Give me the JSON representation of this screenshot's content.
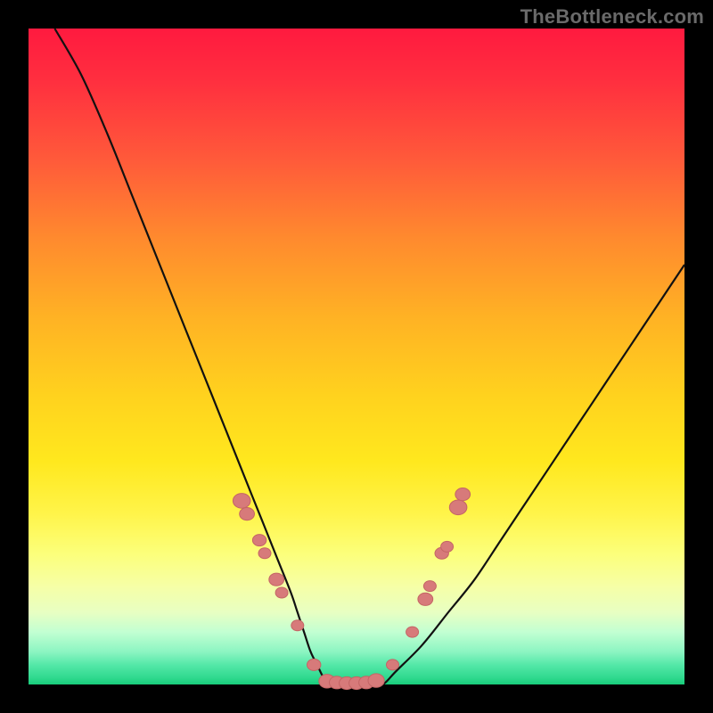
{
  "watermark": "TheBottleneck.com",
  "colors": {
    "frame": "#000000",
    "gradient_top": "#ff1a3f",
    "gradient_bottom": "#18cc7a",
    "curve": "#111111",
    "marker_fill": "#d77a7a",
    "marker_stroke": "#c46565"
  },
  "chart_data": {
    "type": "line",
    "title": "",
    "xlabel": "",
    "ylabel": "",
    "xlim": [
      0,
      100
    ],
    "ylim": [
      0,
      100
    ],
    "grid": false,
    "legend": false,
    "series": [
      {
        "name": "bottleneck-curve",
        "x": [
          4,
          8,
          12,
          16,
          20,
          24,
          28,
          30,
          32,
          34,
          36,
          38,
          40,
          41,
          42,
          43,
          44,
          45,
          46,
          47,
          48,
          50,
          52,
          54,
          56,
          60,
          64,
          68,
          72,
          76,
          80,
          84,
          88,
          92,
          96,
          100
        ],
        "y": [
          100,
          93,
          84,
          74,
          64,
          54,
          44,
          39,
          34,
          29,
          24,
          19,
          14,
          11,
          8,
          5,
          3,
          1,
          0,
          0,
          0,
          0,
          0,
          0,
          2,
          6,
          11,
          16,
          22,
          28,
          34,
          40,
          46,
          52,
          58,
          64
        ]
      }
    ],
    "markers": [
      {
        "x": 32.5,
        "y": 28,
        "r": 1.4
      },
      {
        "x": 33.3,
        "y": 26,
        "r": 1.2
      },
      {
        "x": 35.2,
        "y": 22,
        "r": 1.1
      },
      {
        "x": 36.0,
        "y": 20,
        "r": 1.0
      },
      {
        "x": 37.8,
        "y": 16,
        "r": 1.2
      },
      {
        "x": 38.6,
        "y": 14,
        "r": 1.0
      },
      {
        "x": 41.0,
        "y": 9,
        "r": 1.0
      },
      {
        "x": 43.5,
        "y": 3,
        "r": 1.1
      },
      {
        "x": 45.5,
        "y": 0.5,
        "r": 1.3
      },
      {
        "x": 47.0,
        "y": 0.3,
        "r": 1.2
      },
      {
        "x": 48.5,
        "y": 0.2,
        "r": 1.2
      },
      {
        "x": 50.0,
        "y": 0.2,
        "r": 1.2
      },
      {
        "x": 51.5,
        "y": 0.3,
        "r": 1.2
      },
      {
        "x": 53.0,
        "y": 0.6,
        "r": 1.3
      },
      {
        "x": 55.5,
        "y": 3,
        "r": 1.0
      },
      {
        "x": 58.5,
        "y": 8,
        "r": 1.0
      },
      {
        "x": 60.5,
        "y": 13,
        "r": 1.2
      },
      {
        "x": 61.2,
        "y": 15,
        "r": 1.0
      },
      {
        "x": 63.0,
        "y": 20,
        "r": 1.1
      },
      {
        "x": 63.8,
        "y": 21,
        "r": 1.0
      },
      {
        "x": 65.5,
        "y": 27,
        "r": 1.4
      },
      {
        "x": 66.2,
        "y": 29,
        "r": 1.2
      }
    ]
  }
}
